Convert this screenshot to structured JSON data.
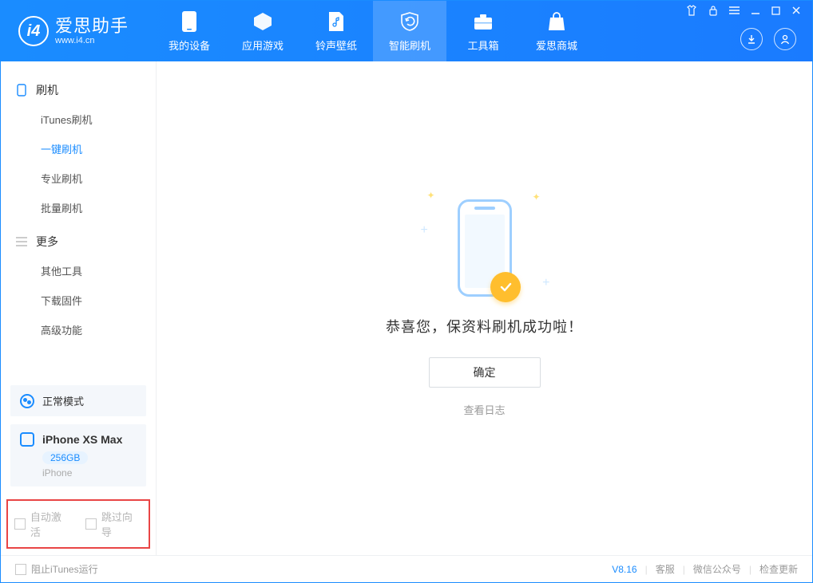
{
  "app": {
    "name_cn": "爱思助手",
    "url": "www.i4.cn",
    "logo_letter": "i4"
  },
  "tabs": {
    "device": "我的设备",
    "apps": "应用游戏",
    "ringtones": "铃声壁纸",
    "flash": "智能刷机",
    "toolbox": "工具箱",
    "store": "爱思商城"
  },
  "sidebar": {
    "group1_title": "刷机",
    "group1_items": {
      "itunes": "iTunes刷机",
      "onekey": "一键刷机",
      "pro": "专业刷机",
      "batch": "批量刷机"
    },
    "group2_title": "更多",
    "group2_items": {
      "other": "其他工具",
      "firmware": "下载固件",
      "advanced": "高级功能"
    }
  },
  "mode_chip": "正常模式",
  "device": {
    "name": "iPhone XS Max",
    "capacity": "256GB",
    "type": "iPhone"
  },
  "options": {
    "auto_activate": "自动激活",
    "skip_guide": "跳过向导"
  },
  "success": {
    "message": "恭喜您，保资料刷机成功啦！",
    "ok": "确定",
    "view_log": "查看日志"
  },
  "footer": {
    "block_itunes": "阻止iTunes运行",
    "version": "V8.16",
    "support": "客服",
    "wechat": "微信公众号",
    "update": "检查更新"
  }
}
